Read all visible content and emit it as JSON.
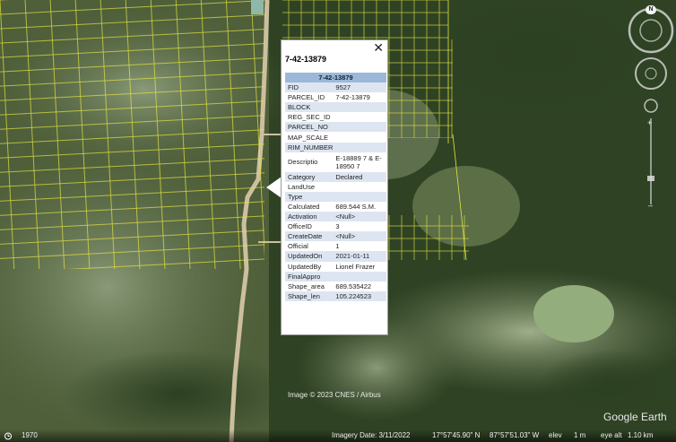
{
  "popup": {
    "title": "7-42-13879",
    "header": "7-42-13879",
    "close_glyph": "✕",
    "rows": [
      {
        "field": "FID",
        "value": "9527"
      },
      {
        "field": "PARCEL_ID",
        "value": "7-42-13879"
      },
      {
        "field": "BLOCK",
        "value": ""
      },
      {
        "field": "REG_SEC_ID",
        "value": ""
      },
      {
        "field": "PARCEL_NO",
        "value": ""
      },
      {
        "field": "MAP_SCALE",
        "value": ""
      },
      {
        "field": "RIM_NUMBER",
        "value": ""
      },
      {
        "field": "Descriptio",
        "value": "E-18889 7 & E-18950 7"
      },
      {
        "field": "Category",
        "value": "Declared"
      },
      {
        "field": "LandUse",
        "value": ""
      },
      {
        "field": "Type",
        "value": ""
      },
      {
        "field": "Calculated",
        "value": "689.544 S.M."
      },
      {
        "field": "Activation",
        "value": "<Null>"
      },
      {
        "field": "OfficeID",
        "value": "3"
      },
      {
        "field": "CreateDate",
        "value": "<Null>"
      },
      {
        "field": "Official",
        "value": "1"
      },
      {
        "field": "UpdatedOn",
        "value": "2021-01-11"
      },
      {
        "field": "UpdatedBy",
        "value": "Lionel Frazer"
      },
      {
        "field": "FinalAppro",
        "value": ""
      },
      {
        "field": "Shape_area",
        "value": "689.535422"
      },
      {
        "field": "Shape_len",
        "value": "105.224523"
      }
    ]
  },
  "map": {
    "copyright": "Image © 2023 CNES / Airbus",
    "logo": "Google Earth",
    "compass_letter": "N",
    "historical_year": "1970",
    "footer": {
      "imagery_date": "Imagery Date: 3/11/2022",
      "lat": "17°57'45.90\" N",
      "lon": "87°57'51.03\" W",
      "elev": "elev",
      "elev_value": "1 m",
      "eye_alt": "eye alt",
      "eye_alt_value": "1.10 km"
    },
    "colors": {
      "parcel_lines": "#e8e640",
      "popup_header": "#9cb8d8",
      "popup_alt_row": "#dde5f1"
    }
  }
}
